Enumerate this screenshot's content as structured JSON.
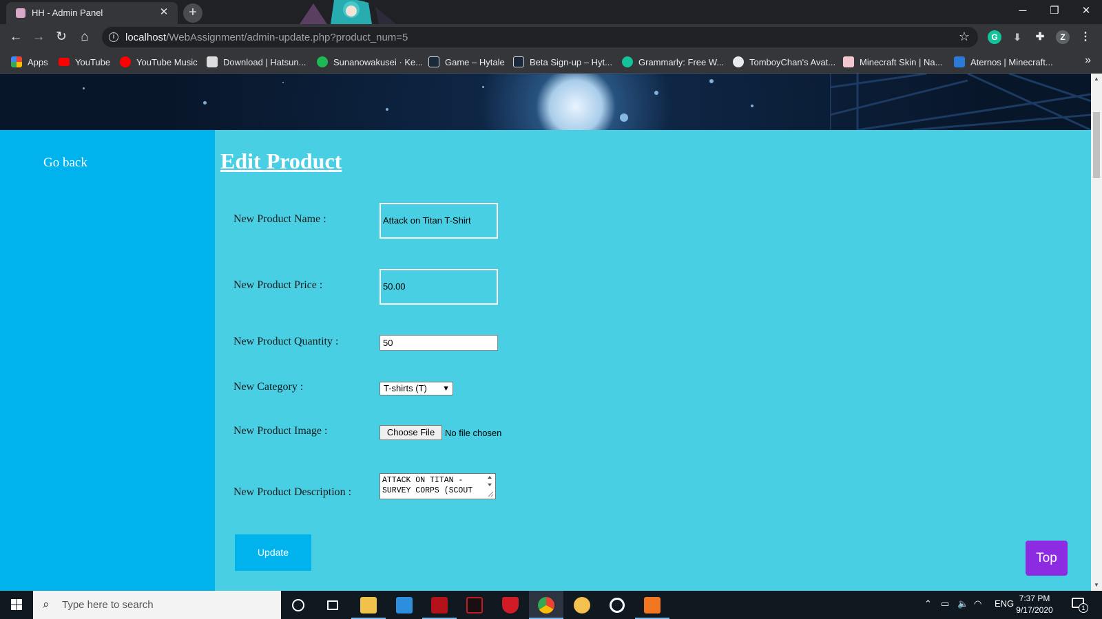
{
  "browser": {
    "tab_title": "HH - Admin Panel",
    "tab_close": "✕",
    "new_tab": "+",
    "window_controls": {
      "minimize": "─",
      "restore": "❐",
      "close": "✕"
    },
    "nav": {
      "back": "←",
      "forward": "→",
      "reload": "↻",
      "home": "⌂"
    },
    "url_host": "localhost",
    "url_path": "/WebAssignment/admin-update.php?product_num=5",
    "star": "☆",
    "profile_initial": "Z",
    "menu": "⋮"
  },
  "bookmarks": [
    {
      "label": "Apps",
      "icon": "apps-grid-icon",
      "color": "#ea4335"
    },
    {
      "label": "YouTube",
      "icon": "youtube-icon",
      "color": "#ff0000"
    },
    {
      "label": "YouTube Music",
      "icon": "youtube-music-icon",
      "color": "#ff0000"
    },
    {
      "label": "Download | Hatsun...",
      "icon": "page-icon",
      "color": "#dddddd"
    },
    {
      "label": "Sunanowakusei · Ke...",
      "icon": "spotify-icon",
      "color": "#1db954"
    },
    {
      "label": "Game – Hytale",
      "icon": "hytale-icon",
      "color": "#ffffff"
    },
    {
      "label": "Beta Sign-up – Hyt...",
      "icon": "hytale-icon",
      "color": "#ffffff"
    },
    {
      "label": "Grammarly: Free W...",
      "icon": "grammarly-icon",
      "color": "#15c39a"
    },
    {
      "label": "TomboyChan's Avat...",
      "icon": "globe-icon",
      "color": "#e8eaed"
    },
    {
      "label": "Minecraft Skin | Na...",
      "icon": "minecraft-skin-icon",
      "color": "#f4c7d0"
    },
    {
      "label": "Aternos | Minecraft...",
      "icon": "aternos-icon",
      "color": "#2b79d8"
    }
  ],
  "bookmarks_more": "»",
  "page": {
    "go_back": "Go back",
    "title": "Edit Product",
    "labels": {
      "name": "New Product Name :",
      "price": "New Product Price :",
      "quantity": "New Product Quantity :",
      "category": "New Category :",
      "image": "New Product Image :",
      "description": "New Product Description :"
    },
    "values": {
      "name": "Attack on Titan T-Shirt",
      "price": "50.00",
      "quantity": "50",
      "category": "T-shirts (T)",
      "description": "ATTACK ON TITAN - SURVEY CORPS (SCOUT"
    },
    "file_button": "Choose File",
    "file_status": "No file chosen",
    "update_button": "Update",
    "top_button": "Top"
  },
  "colors": {
    "sidebar": "#00b3ec",
    "main": "#48cfe3",
    "top_button": "#8d2be2"
  },
  "taskbar": {
    "search_placeholder": "Type here to search",
    "language": "ENG",
    "time": "7:37 PM",
    "date": "9/17/2020",
    "notifications": "1"
  }
}
